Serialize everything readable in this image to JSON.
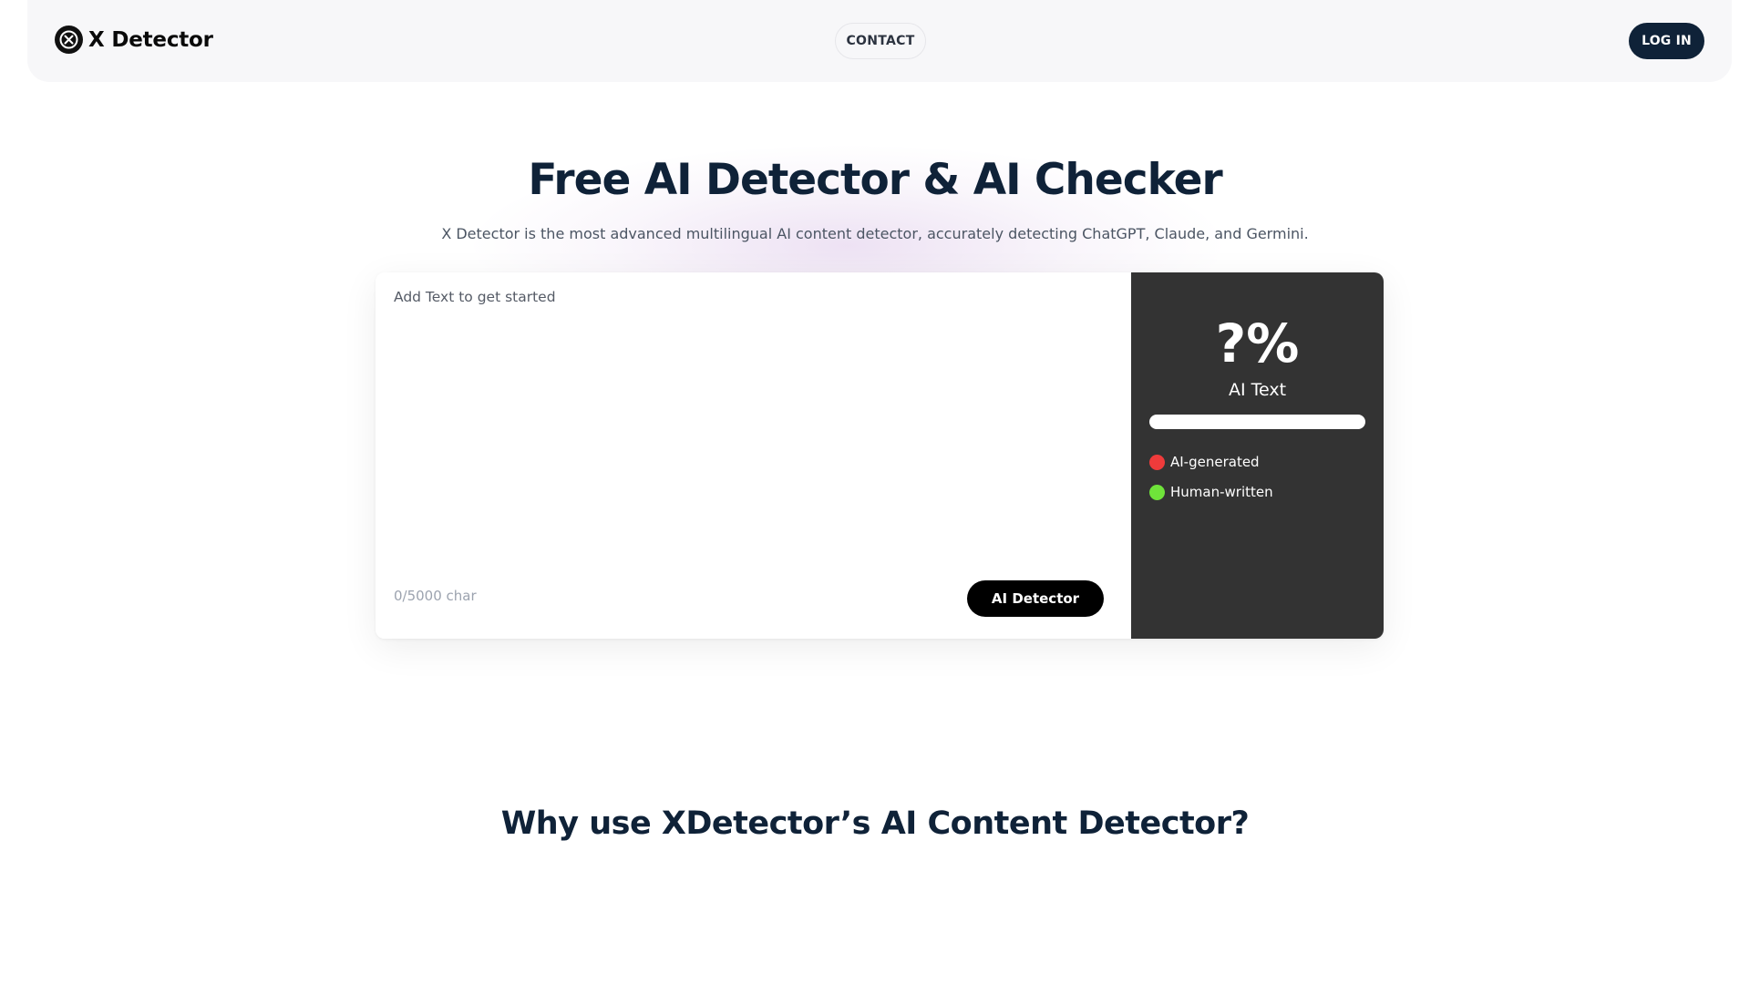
{
  "header": {
    "brand": "X Detector",
    "logo_icon": "x-circle-icon",
    "contact_label": "CONTACT",
    "login_label": "LOG IN"
  },
  "hero": {
    "title": "Free AI Detector & AI Checker",
    "subtitle": "X Detector is the most advanced multilingual AI content detector, accurately detecting ChatGPT, Claude, and Germini."
  },
  "editor": {
    "placeholder": "Add Text to get started",
    "char_count": "0/5000 char",
    "submit_label": "AI Detector"
  },
  "result": {
    "value": "?%",
    "label": "AI Text",
    "legend": [
      {
        "label": "AI-generated",
        "color": "#ef3b3b"
      },
      {
        "label": "Human-written",
        "color": "#6fe33a"
      }
    ]
  },
  "section": {
    "title": "Why use XDetector’s AI Content Detector?"
  },
  "colors": {
    "navy": "#0f2238",
    "result_panel": "#333333",
    "ai_dot": "#ef3b3b",
    "human_dot": "#6fe33a"
  }
}
